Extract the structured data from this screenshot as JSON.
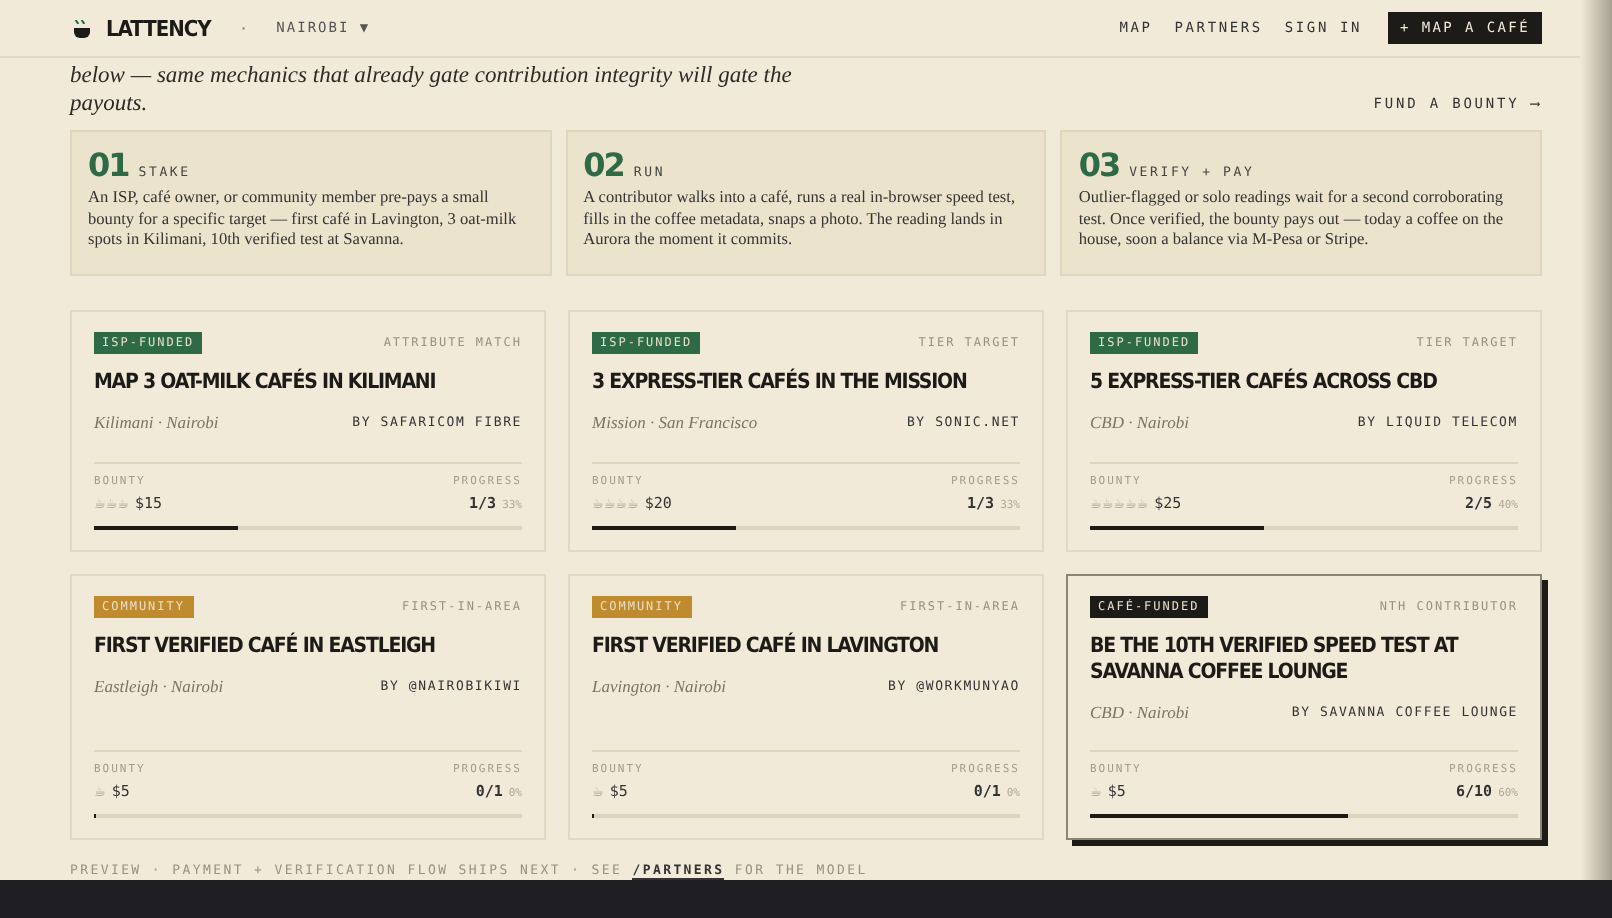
{
  "header": {
    "logo": "LATTENCY",
    "separator": "·",
    "city": "NAIROBI",
    "city_caret": "▼",
    "nav": [
      "MAP",
      "PARTNERS",
      "SIGN IN"
    ],
    "cta": "+ MAP A CAFÉ"
  },
  "intro": {
    "text": "*below — same mechanics that already gate contribution integrity will gate the payouts.*",
    "link": "FUND A BOUNTY ⟶"
  },
  "steps": [
    {
      "number": "01",
      "label": "STAKE",
      "text": "An ISP, café owner, or community member pre-pays a small bounty for a specific target — first café in Lavington, 3 oat-milk spots in Kilimani, 10th verified test at Savanna."
    },
    {
      "number": "02",
      "label": "RUN",
      "text": "A contributor walks into a café, runs a real in-browser speed test, fills in the coffee metadata, snaps a photo. The reading lands in Aurora the moment it commits."
    },
    {
      "number": "03",
      "label": "VERIFY + PAY",
      "text": "Outlier-flagged or solo readings wait for a second corroborating test. Once verified, the bounty pays out — today a coffee on the house, soon a balance via M-Pesa or Stripe."
    }
  ],
  "bounties": [
    {
      "tag": "ISP-FUNDED",
      "color": "#2d6a45",
      "type": "ATTRIBUTE MATCH",
      "title": "MAP 3 OAT-MILK CAFÉS IN KILIMANI",
      "place": "Kilimani · Nairobi",
      "sponsor": "BY SAFARICOM FIBRE",
      "bounty_label": "BOUNTY",
      "cups": "☕☕☕",
      "amount": "$15",
      "progress_label": "PROGRESS",
      "progress": "1/3",
      "percent": "33%",
      "level": 0.33,
      "featured": false
    },
    {
      "tag": "ISP-FUNDED",
      "color": "#2d6a45",
      "type": "TIER TARGET",
      "title": "3 EXPRESS-TIER CAFÉS IN THE MISSION",
      "place": "Mission · San Francisco",
      "sponsor": "BY SONIC.NET",
      "bounty_label": "BOUNTY",
      "cups": "☕☕☕☕",
      "amount": "$20",
      "progress_label": "PROGRESS",
      "progress": "1/3",
      "percent": "33%",
      "level": 0.33,
      "featured": false
    },
    {
      "tag": "ISP-FUNDED",
      "color": "#2d6a45",
      "type": "TIER TARGET",
      "title": "5 EXPRESS-TIER CAFÉS ACROSS CBD",
      "place": "CBD · Nairobi",
      "sponsor": "BY LIQUID TELECOM",
      "bounty_label": "BOUNTY",
      "cups": "☕☕☕☕☕",
      "amount": "$25",
      "progress_label": "PROGRESS",
      "progress": "2/5",
      "percent": "40%",
      "level": 0.4,
      "featured": false
    },
    {
      "tag": "COMMUNITY",
      "color": "#c08a2e",
      "type": "FIRST-IN-AREA",
      "title": "FIRST VERIFIED CAFÉ IN EASTLEIGH",
      "place": "Eastleigh · Nairobi",
      "sponsor": "BY @NAIROBIKIWI",
      "bounty_label": "BOUNTY",
      "cups": "☕",
      "amount": "$5",
      "progress_label": "PROGRESS",
      "progress": "0/1",
      "percent": "0%",
      "level": 0,
      "featured": false
    },
    {
      "tag": "COMMUNITY",
      "color": "#c08a2e",
      "type": "FIRST-IN-AREA",
      "title": "FIRST VERIFIED CAFÉ IN LAVINGTON",
      "place": "Lavington · Nairobi",
      "sponsor": "BY @WORKMUNYAO",
      "bounty_label": "BOUNTY",
      "cups": "☕",
      "amount": "$5",
      "progress_label": "PROGRESS",
      "progress": "0/1",
      "percent": "0%",
      "level": 0,
      "featured": false
    },
    {
      "tag": "CAFÉ-FUNDED",
      "color": "#1c1b18",
      "type": "NTH CONTRIBUTOR",
      "title": "BE THE 10TH VERIFIED SPEED TEST AT SAVANNA COFFEE LOUNGE",
      "place": "CBD · Nairobi",
      "sponsor": "BY SAVANNA COFFEE LOUNGE",
      "bounty_label": "BOUNTY",
      "cups": "☕",
      "amount": "$5",
      "progress_label": "PROGRESS",
      "progress": "6/10",
      "percent": "60%",
      "level": 0.6,
      "featured": true
    }
  ],
  "footer_note": {
    "before": "PREVIEW · PAYMENT + VERIFICATION FLOW SHIPS NEXT · SEE",
    "link": "/PARTNERS",
    "after": "FOR THE MODEL"
  }
}
